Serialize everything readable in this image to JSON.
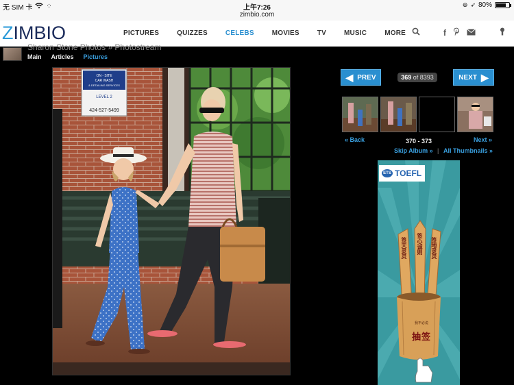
{
  "statusbar": {
    "carrier": "无 SIM 卡",
    "time": "上午7:26",
    "battery_percent": "80%",
    "battery_level": 0.8
  },
  "browser": {
    "url": "zimbio.com"
  },
  "header": {
    "logo": {
      "first": "Z",
      "rest": "IMBIO"
    },
    "nav": [
      "PICTURES",
      "QUIZZES",
      "CELEBS",
      "MOVIES",
      "TV",
      "MUSIC",
      "MORE"
    ],
    "active_nav": "CELEBS"
  },
  "subheader": {
    "breadcrumb": "Sharon Stone Photos  »  Photostream",
    "tabs": [
      "Main",
      "Articles",
      "Pictures"
    ],
    "active_tab": "Pictures"
  },
  "photo": {
    "sign_lines": [
      "ON - SITE",
      "CAR WASH",
      "& DETAILING SERVICES",
      "LEVEL 2",
      "424-527-5499"
    ]
  },
  "gallery": {
    "prev_label": "PREV",
    "next_label": "NEXT",
    "current": "369",
    "of_label": "of 8393",
    "range": "370 - 373",
    "back_label": "« Back",
    "next_link_label": "Next »",
    "skip_album_label": "Skip Album »",
    "separator": "|",
    "all_thumbnails_label": "All Thumbnails »"
  },
  "ad": {
    "ets_label": "ETS",
    "brand": "TOEFL",
    "stick_texts": [
      "签天灵灵",
      "签心诚则",
      "签地灵灵"
    ],
    "jar_small_text": "我不必说",
    "jar_label": "抽签"
  },
  "colors": {
    "accent": "#2a8fd0",
    "link": "#3aa0e0",
    "logo_navy": "#1a2a5a"
  }
}
